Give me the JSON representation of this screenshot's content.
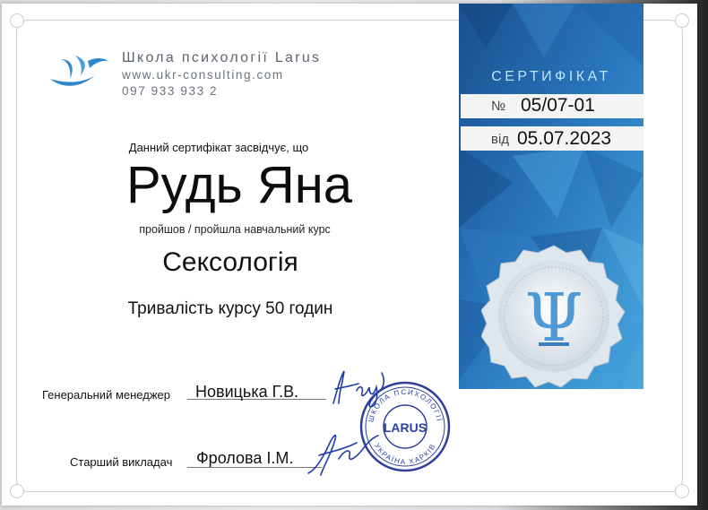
{
  "school": {
    "name": "Школа психології Larus",
    "website": "www.ukr-consulting.com",
    "phone": "097 933 933 2",
    "logo_icon": "larus-bird-logo-icon"
  },
  "certificate": {
    "title": "СЕРТИФІКАТ",
    "number_prefix": "№",
    "number": "05/07-01",
    "date_prefix": "від",
    "date": "05.07.2023",
    "certifies_text": "Данний сертифікат засвідчує, що",
    "recipient": "Рудь Яна",
    "completed_text": "пройшов / пройшла навчальний курс",
    "course": "Сексологія",
    "duration": "Тривалість курсу 50 годин"
  },
  "signatures": {
    "manager_label": "Генеральний менеджер",
    "manager_name": "Новицька Г.В.",
    "lecturer_label": "Старший викладач",
    "lecturer_name": "Фролова І.М."
  },
  "stamp": {
    "center": "LARUS",
    "top_arc": "ШКОЛА ПСИХОЛОГІЇ",
    "bottom_arc": "УКРАЇНА ХАРКІВ"
  },
  "colors": {
    "panel_dark": "#1d5fa3",
    "panel_light": "#3a9ad6",
    "stamp_blue": "#2c3fa0",
    "text_gray": "#5b6470"
  },
  "icons": {
    "seal": "psi-seal-icon"
  }
}
